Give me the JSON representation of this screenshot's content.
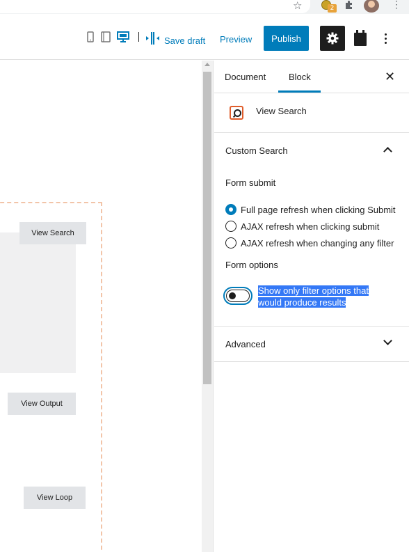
{
  "browser": {
    "extension_badge": "2"
  },
  "toolbar": {
    "save_draft": "Save draft",
    "preview": "Preview",
    "publish": "Publish"
  },
  "canvas": {
    "buttons": [
      "View Search",
      "View Output",
      "View Loop"
    ]
  },
  "sidebar": {
    "tabs": [
      "Document",
      "Block"
    ],
    "active_tab": "Block",
    "block_name": "View Search",
    "custom_search_panel": {
      "title": "Custom Search",
      "form_submit_label": "Form submit",
      "radio_options": [
        "Full page refresh when clicking Submit",
        "AJAX refresh when clicking submit",
        "AJAX refresh when changing any filter"
      ],
      "selected_option": "Full page refresh when clicking Submit",
      "form_options_label": "Form options",
      "toggle_label": "Show only filter options that would produce results",
      "toggle_on": false
    },
    "advanced_panel": {
      "title": "Advanced"
    }
  },
  "colors": {
    "accent": "#007cba",
    "block_icon": "#e05d2b",
    "selection": "#3478f6"
  }
}
